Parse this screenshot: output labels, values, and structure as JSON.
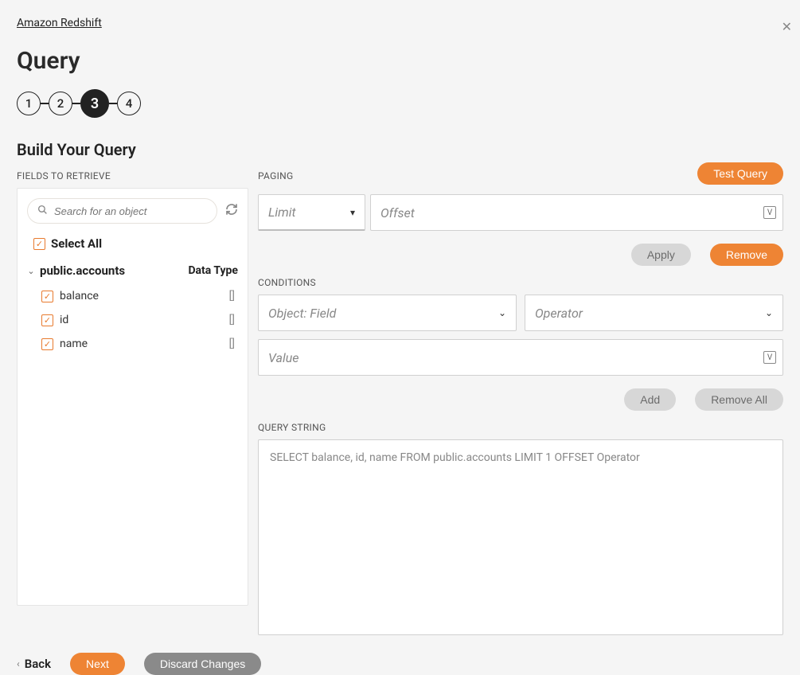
{
  "breadcrumb": {
    "label": "Amazon Redshift"
  },
  "page": {
    "title": "Query",
    "section_title": "Build Your Query"
  },
  "stepper": {
    "steps": [
      "1",
      "2",
      "3",
      "4"
    ],
    "active_index": 2
  },
  "left": {
    "label": "FIELDS TO RETRIEVE",
    "search_placeholder": "Search for an object",
    "select_all": "Select All",
    "object_name": "public.accounts",
    "datatype_header": "Data Type",
    "fields": [
      {
        "name": "balance",
        "dtype": "[]"
      },
      {
        "name": "id",
        "dtype": "[]"
      },
      {
        "name": "name",
        "dtype": "[]"
      }
    ]
  },
  "right": {
    "test_query": "Test Query",
    "paging_label": "PAGING",
    "limit_placeholder": "Limit",
    "offset_placeholder": "Offset",
    "apply": "Apply",
    "remove": "Remove",
    "conditions_label": "CONDITIONS",
    "object_field_placeholder": "Object: Field",
    "operator_placeholder": "Operator",
    "value_placeholder": "Value",
    "add": "Add",
    "remove_all": "Remove All",
    "query_string_label": "QUERY STRING",
    "query_string": "SELECT balance, id, name FROM public.accounts  LIMIT 1  OFFSET Operator"
  },
  "footer": {
    "back": "Back",
    "next": "Next",
    "discard": "Discard Changes"
  }
}
